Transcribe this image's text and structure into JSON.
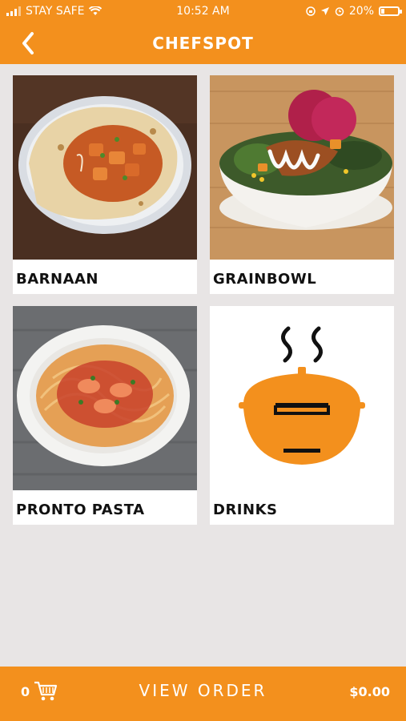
{
  "status_bar": {
    "carrier": "STAY SAFE",
    "time": "10:52 AM",
    "battery_percent": "20%",
    "battery_level": 0.2
  },
  "nav": {
    "title": "CHEFSPOT",
    "back_icon": "chevron-left-icon"
  },
  "categories": [
    {
      "label": "BARNAAN",
      "image": "barnaan-dish-photo"
    },
    {
      "label": "GRAINBOWL",
      "image": "grainbowl-salad-photo"
    },
    {
      "label": "PRONTO PASTA",
      "image": "pasta-bowl-photo"
    },
    {
      "label": "DRINKS",
      "image": "steaming-pot-icon"
    }
  ],
  "bottom_bar": {
    "cart_count": "0",
    "cart_icon": "cart-icon",
    "view_order_label": "VIEW ORDER",
    "total": "$0.00"
  },
  "colors": {
    "brand_orange": "#f3901d",
    "background": "#e8e5e5"
  }
}
